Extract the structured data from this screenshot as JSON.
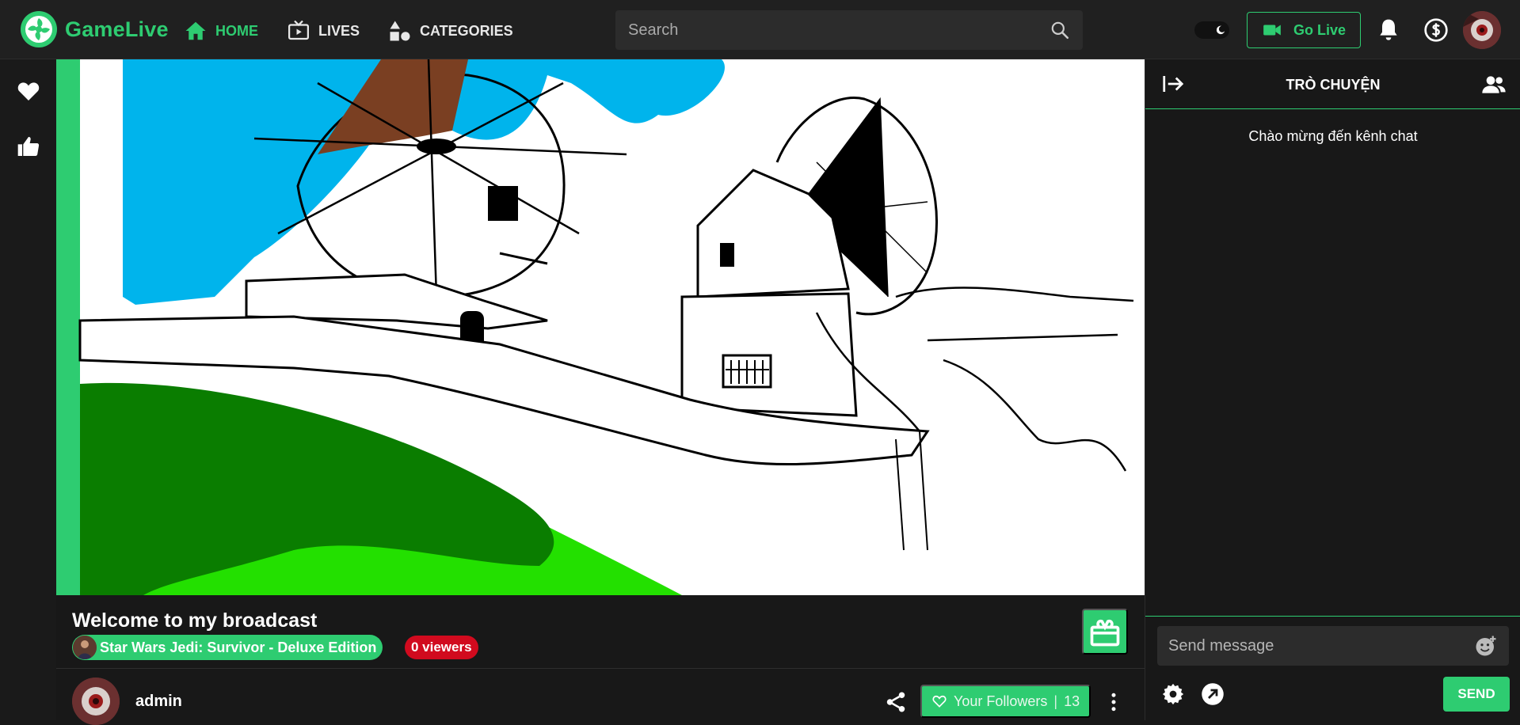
{
  "app": {
    "name": "GameLive"
  },
  "nav": [
    {
      "label": "HOME",
      "icon": "home-icon",
      "active": true
    },
    {
      "label": "LIVES",
      "icon": "tv-icon",
      "active": false
    },
    {
      "label": "CATEGORIES",
      "icon": "shapes-icon",
      "active": false
    }
  ],
  "search": {
    "placeholder": "Search",
    "value": ""
  },
  "header": {
    "go_live_label": "Go Live",
    "theme_toggle": "dark"
  },
  "colors": {
    "accent": "#2ecc71",
    "live_red": "#d10a1e",
    "bg": "#181818"
  },
  "stream": {
    "title": "Welcome to my broadcast",
    "game": "Star Wars Jedi: Survivor - Deluxe Edition",
    "viewers": "0 viewers"
  },
  "streamer": {
    "name": "admin"
  },
  "followers": {
    "label": "Your Followers",
    "count": "13"
  },
  "chat": {
    "title": "TRÒ CHUYỆN",
    "welcome": "Chào mừng đến kênh chat",
    "input_placeholder": "Send message",
    "send_label": "SEND"
  }
}
